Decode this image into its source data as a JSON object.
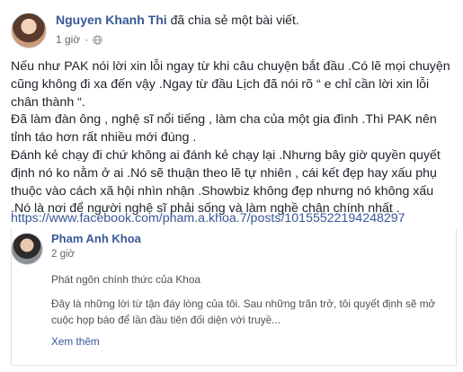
{
  "post": {
    "author_name": "Nguyen Khanh Thi",
    "author_action": "đã chia sẻ một bài viết.",
    "time": "1 giờ",
    "separator": "·",
    "privacy_icon": "globe-icon",
    "body": [
      "Nếu như PAK nói lời xin lỗi ngay từ khi câu chuyện bắt đầu .Có lẽ mọi chuyện cũng không đi xa đến vậy .Ngay từ đầu Lịch đã nói rõ “ e chỉ cần lời xin lỗi chân thành “.",
      "Đã làm đàn ông , nghệ sĩ nổi tiếng , làm cha của một gia đình .Thì PAK nên tỉnh táo hơn rất nhiều mới đúng .",
      "Đánh kẻ chạy đi chứ không ai đánh kẻ chạy lại .Nhưng bây giờ quyền quyết định nó ko nằm ở ai .Nó sẽ thuận theo lẽ tự nhiên , cái kết đẹp hay xấu phụ thuộc vào cách xã hội nhìn nhận .Showbiz không đẹp nhưng nó không xấu .Nó là nơi để người nghệ sĩ phải sống và làm nghề chân chính nhất ."
    ],
    "link": "https://www.facebook.com/pham.a.khoa.7/posts/10155522194248297"
  },
  "shared": {
    "author_name": "Pham Anh Khoa",
    "time": "2 giờ",
    "line1": "Phát ngôn chính thức của Khoa",
    "paragraph": "Đây là những lời từ tận đáy lòng của tôi. Sau những trăn trở, tôi quyết định sẽ mở cuộc họp báo để lần đầu tiên đối diện với truyề...",
    "see_more": "Xem thêm"
  },
  "colors": {
    "link": "#385898",
    "text": "#1d2129",
    "muted": "#616770"
  }
}
